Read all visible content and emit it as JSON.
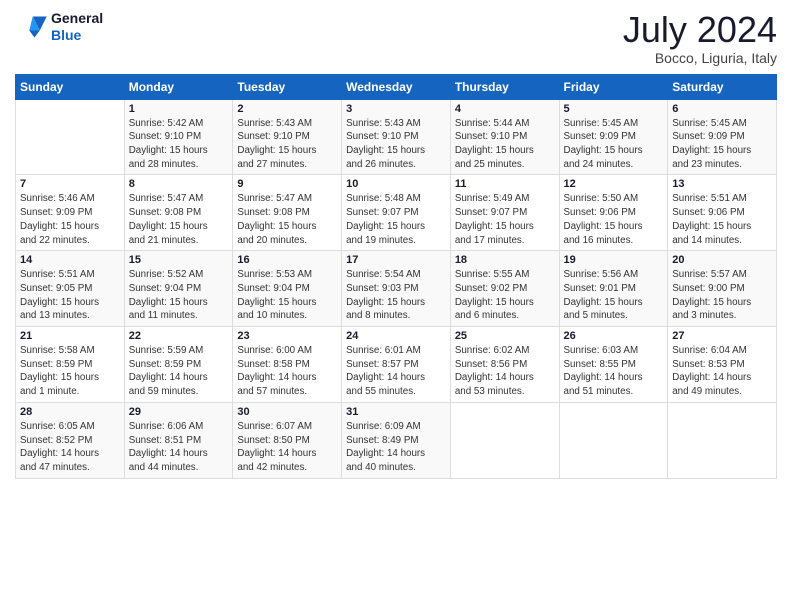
{
  "logo": {
    "text_general": "General",
    "text_blue": "Blue"
  },
  "header": {
    "title": "July 2024",
    "subtitle": "Bocco, Liguria, Italy"
  },
  "weekdays": [
    "Sunday",
    "Monday",
    "Tuesday",
    "Wednesday",
    "Thursday",
    "Friday",
    "Saturday"
  ],
  "weeks": [
    [
      {
        "day": "",
        "info": ""
      },
      {
        "day": "1",
        "info": "Sunrise: 5:42 AM\nSunset: 9:10 PM\nDaylight: 15 hours\nand 28 minutes."
      },
      {
        "day": "2",
        "info": "Sunrise: 5:43 AM\nSunset: 9:10 PM\nDaylight: 15 hours\nand 27 minutes."
      },
      {
        "day": "3",
        "info": "Sunrise: 5:43 AM\nSunset: 9:10 PM\nDaylight: 15 hours\nand 26 minutes."
      },
      {
        "day": "4",
        "info": "Sunrise: 5:44 AM\nSunset: 9:10 PM\nDaylight: 15 hours\nand 25 minutes."
      },
      {
        "day": "5",
        "info": "Sunrise: 5:45 AM\nSunset: 9:09 PM\nDaylight: 15 hours\nand 24 minutes."
      },
      {
        "day": "6",
        "info": "Sunrise: 5:45 AM\nSunset: 9:09 PM\nDaylight: 15 hours\nand 23 minutes."
      }
    ],
    [
      {
        "day": "7",
        "info": "Sunrise: 5:46 AM\nSunset: 9:09 PM\nDaylight: 15 hours\nand 22 minutes."
      },
      {
        "day": "8",
        "info": "Sunrise: 5:47 AM\nSunset: 9:08 PM\nDaylight: 15 hours\nand 21 minutes."
      },
      {
        "day": "9",
        "info": "Sunrise: 5:47 AM\nSunset: 9:08 PM\nDaylight: 15 hours\nand 20 minutes."
      },
      {
        "day": "10",
        "info": "Sunrise: 5:48 AM\nSunset: 9:07 PM\nDaylight: 15 hours\nand 19 minutes."
      },
      {
        "day": "11",
        "info": "Sunrise: 5:49 AM\nSunset: 9:07 PM\nDaylight: 15 hours\nand 17 minutes."
      },
      {
        "day": "12",
        "info": "Sunrise: 5:50 AM\nSunset: 9:06 PM\nDaylight: 15 hours\nand 16 minutes."
      },
      {
        "day": "13",
        "info": "Sunrise: 5:51 AM\nSunset: 9:06 PM\nDaylight: 15 hours\nand 14 minutes."
      }
    ],
    [
      {
        "day": "14",
        "info": "Sunrise: 5:51 AM\nSunset: 9:05 PM\nDaylight: 15 hours\nand 13 minutes."
      },
      {
        "day": "15",
        "info": "Sunrise: 5:52 AM\nSunset: 9:04 PM\nDaylight: 15 hours\nand 11 minutes."
      },
      {
        "day": "16",
        "info": "Sunrise: 5:53 AM\nSunset: 9:04 PM\nDaylight: 15 hours\nand 10 minutes."
      },
      {
        "day": "17",
        "info": "Sunrise: 5:54 AM\nSunset: 9:03 PM\nDaylight: 15 hours\nand 8 minutes."
      },
      {
        "day": "18",
        "info": "Sunrise: 5:55 AM\nSunset: 9:02 PM\nDaylight: 15 hours\nand 6 minutes."
      },
      {
        "day": "19",
        "info": "Sunrise: 5:56 AM\nSunset: 9:01 PM\nDaylight: 15 hours\nand 5 minutes."
      },
      {
        "day": "20",
        "info": "Sunrise: 5:57 AM\nSunset: 9:00 PM\nDaylight: 15 hours\nand 3 minutes."
      }
    ],
    [
      {
        "day": "21",
        "info": "Sunrise: 5:58 AM\nSunset: 8:59 PM\nDaylight: 15 hours\nand 1 minute."
      },
      {
        "day": "22",
        "info": "Sunrise: 5:59 AM\nSunset: 8:59 PM\nDaylight: 14 hours\nand 59 minutes."
      },
      {
        "day": "23",
        "info": "Sunrise: 6:00 AM\nSunset: 8:58 PM\nDaylight: 14 hours\nand 57 minutes."
      },
      {
        "day": "24",
        "info": "Sunrise: 6:01 AM\nSunset: 8:57 PM\nDaylight: 14 hours\nand 55 minutes."
      },
      {
        "day": "25",
        "info": "Sunrise: 6:02 AM\nSunset: 8:56 PM\nDaylight: 14 hours\nand 53 minutes."
      },
      {
        "day": "26",
        "info": "Sunrise: 6:03 AM\nSunset: 8:55 PM\nDaylight: 14 hours\nand 51 minutes."
      },
      {
        "day": "27",
        "info": "Sunrise: 6:04 AM\nSunset: 8:53 PM\nDaylight: 14 hours\nand 49 minutes."
      }
    ],
    [
      {
        "day": "28",
        "info": "Sunrise: 6:05 AM\nSunset: 8:52 PM\nDaylight: 14 hours\nand 47 minutes."
      },
      {
        "day": "29",
        "info": "Sunrise: 6:06 AM\nSunset: 8:51 PM\nDaylight: 14 hours\nand 44 minutes."
      },
      {
        "day": "30",
        "info": "Sunrise: 6:07 AM\nSunset: 8:50 PM\nDaylight: 14 hours\nand 42 minutes."
      },
      {
        "day": "31",
        "info": "Sunrise: 6:09 AM\nSunset: 8:49 PM\nDaylight: 14 hours\nand 40 minutes."
      },
      {
        "day": "",
        "info": ""
      },
      {
        "day": "",
        "info": ""
      },
      {
        "day": "",
        "info": ""
      }
    ]
  ]
}
